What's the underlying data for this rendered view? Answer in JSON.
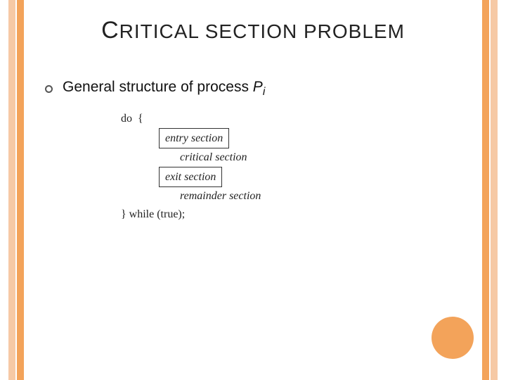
{
  "title": {
    "leadCap": "C",
    "rest": "RITICAL SECTION PROBLEM"
  },
  "bullet": {
    "prefix": "General structure of process ",
    "pLetter": "P",
    "pSub": "i"
  },
  "code": {
    "do_open": "do  {",
    "entry": "entry section",
    "critical": "critical section",
    "exit": "exit section",
    "remainder": "remainder section",
    "close": "} while (true);"
  }
}
